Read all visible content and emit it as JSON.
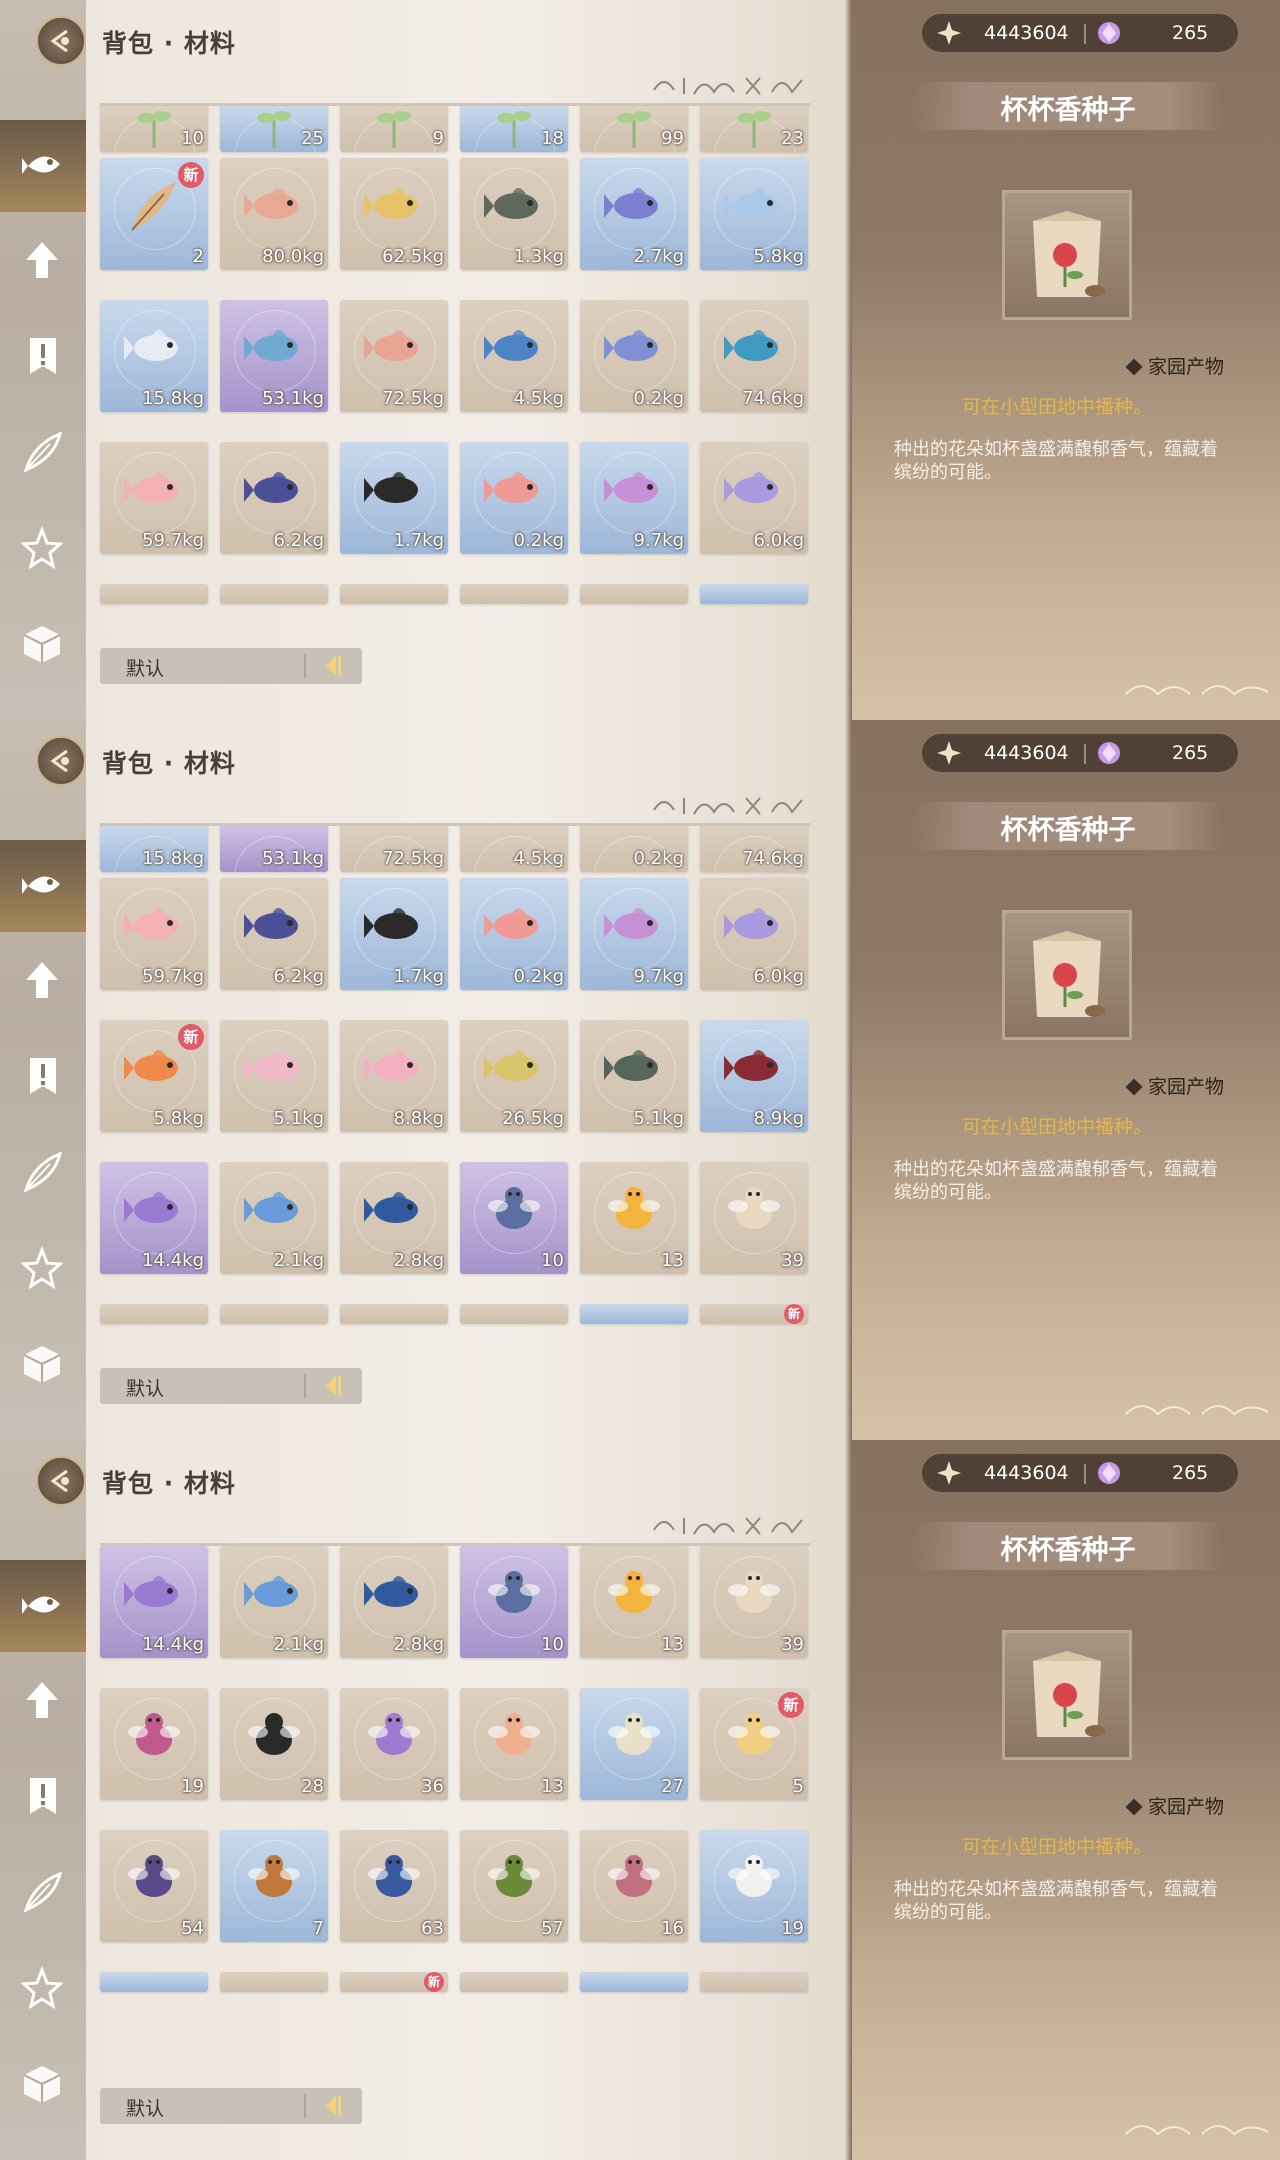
{
  "screens": [
    {
      "breadcrumb": "背包 · 材料",
      "sort_label": "默认",
      "currency": {
        "gold": "4443604",
        "gems": "265"
      },
      "detail": {
        "title": "杯杯香种子",
        "category": "家园产物",
        "usage": "可在小型田地中播种。",
        "description": "种出的花朵如杯盏盛满馥郁香气，蕴藏着缤纷的可能。"
      },
      "rows": [
        {
          "partial": "top",
          "items": [
            {
              "qty": "10",
              "color": "c-tan",
              "art": "sprout"
            },
            {
              "qty": "25",
              "color": "c-blue",
              "art": "sprout"
            },
            {
              "qty": "9",
              "color": "c-tan",
              "art": "sprout"
            },
            {
              "qty": "18",
              "color": "c-blue",
              "art": "sprout"
            },
            {
              "qty": "99",
              "color": "c-tan",
              "art": "sprout"
            },
            {
              "qty": "23",
              "color": "c-tan",
              "art": "sprout"
            }
          ]
        },
        {
          "items": [
            {
              "qty": "2",
              "color": "c-blue",
              "art": "feather",
              "new": "新"
            },
            {
              "qty": "80.0kg",
              "color": "c-tan",
              "art": "fish",
              "fish": "#e8a894"
            },
            {
              "qty": "62.5kg",
              "color": "c-tan",
              "art": "fish",
              "fish": "#e8c26a"
            },
            {
              "qty": "1.3kg",
              "color": "c-tan",
              "art": "fish",
              "fish": "#5f6a5c"
            },
            {
              "qty": "2.7kg",
              "color": "c-blue",
              "art": "fish",
              "fish": "#7c7fd0"
            },
            {
              "qty": "5.8kg",
              "color": "c-blue",
              "art": "fish",
              "fish": "#a9c9e8"
            }
          ]
        },
        {
          "items": [
            {
              "qty": "15.8kg",
              "color": "c-blue",
              "art": "fish",
              "fish": "#e7ecf2"
            },
            {
              "qty": "53.1kg",
              "color": "c-purple",
              "art": "fish",
              "fish": "#6fa8d0"
            },
            {
              "qty": "72.5kg",
              "color": "c-tan",
              "art": "fish",
              "fish": "#e9a393"
            },
            {
              "qty": "4.5kg",
              "color": "c-tan",
              "art": "fish",
              "fish": "#4d84c8"
            },
            {
              "qty": "0.2kg",
              "color": "c-tan",
              "art": "fish",
              "fish": "#7f90d4"
            },
            {
              "qty": "74.6kg",
              "color": "c-tan",
              "art": "fish",
              "fish": "#3f9ac4"
            }
          ]
        },
        {
          "items": [
            {
              "qty": "59.7kg",
              "color": "c-tan",
              "art": "fish",
              "fish": "#f3b1b3"
            },
            {
              "qty": "6.2kg",
              "color": "c-tan",
              "art": "fish",
              "fish": "#4a4f96"
            },
            {
              "qty": "1.7kg",
              "color": "c-blue",
              "art": "fish",
              "fish": "#2b2a2a"
            },
            {
              "qty": "0.2kg",
              "color": "c-blue",
              "art": "fish",
              "fish": "#f09a95"
            },
            {
              "qty": "9.7kg",
              "color": "c-blue",
              "art": "fish",
              "fish": "#c690d6"
            },
            {
              "qty": "6.0kg",
              "color": "c-tan",
              "art": "fish",
              "fish": "#a899e0"
            }
          ]
        },
        {
          "partial": "bottom",
          "items": [
            {
              "qty": "",
              "color": "c-tan",
              "art": "none"
            },
            {
              "qty": "",
              "color": "c-tan",
              "art": "none"
            },
            {
              "qty": "",
              "color": "c-tan",
              "art": "none"
            },
            {
              "qty": "",
              "color": "c-tan",
              "art": "none"
            },
            {
              "qty": "",
              "color": "c-tan",
              "art": "none"
            },
            {
              "qty": "",
              "color": "c-blue",
              "art": "none"
            }
          ]
        }
      ]
    },
    {
      "breadcrumb": "背包 · 材料",
      "sort_label": "默认",
      "currency": {
        "gold": "4443604",
        "gems": "265"
      },
      "detail": {
        "title": "杯杯香种子",
        "category": "家园产物",
        "usage": "可在小型田地中播种。",
        "description": "种出的花朵如杯盏盛满馥郁香气，蕴藏着缤纷的可能。"
      },
      "rows": [
        {
          "partial": "top",
          "items": [
            {
              "qty": "15.8kg",
              "color": "c-blue",
              "art": "none"
            },
            {
              "qty": "53.1kg",
              "color": "c-purple",
              "art": "none"
            },
            {
              "qty": "72.5kg",
              "color": "c-tan",
              "art": "none"
            },
            {
              "qty": "4.5kg",
              "color": "c-tan",
              "art": "none"
            },
            {
              "qty": "0.2kg",
              "color": "c-tan",
              "art": "none"
            },
            {
              "qty": "74.6kg",
              "color": "c-tan",
              "art": "none"
            }
          ]
        },
        {
          "items": [
            {
              "qty": "59.7kg",
              "color": "c-tan",
              "art": "fish",
              "fish": "#f3b1b3"
            },
            {
              "qty": "6.2kg",
              "color": "c-tan",
              "art": "fish",
              "fish": "#4a4f96"
            },
            {
              "qty": "1.7kg",
              "color": "c-blue",
              "art": "fish",
              "fish": "#2b2a2a"
            },
            {
              "qty": "0.2kg",
              "color": "c-blue",
              "art": "fish",
              "fish": "#f09a95"
            },
            {
              "qty": "9.7kg",
              "color": "c-blue",
              "art": "fish",
              "fish": "#c690d6"
            },
            {
              "qty": "6.0kg",
              "color": "c-tan",
              "art": "fish",
              "fish": "#a899e0"
            }
          ]
        },
        {
          "items": [
            {
              "qty": "5.8kg",
              "color": "c-tan",
              "art": "fish",
              "fish": "#f08a4a",
              "new": "新"
            },
            {
              "qty": "5.1kg",
              "color": "c-tan",
              "art": "fish",
              "fish": "#f2b8c8"
            },
            {
              "qty": "8.8kg",
              "color": "c-tan",
              "art": "fish",
              "fish": "#f2b0c2"
            },
            {
              "qty": "26.5kg",
              "color": "c-tan",
              "art": "fish",
              "fish": "#d8c46a"
            },
            {
              "qty": "5.1kg",
              "color": "c-tan",
              "art": "fish",
              "fish": "#56665a"
            },
            {
              "qty": "8.9kg",
              "color": "c-blue",
              "art": "fish",
              "fish": "#8a2a35"
            }
          ]
        },
        {
          "items": [
            {
              "qty": "14.4kg",
              "color": "c-purple",
              "art": "fish",
              "fish": "#9a7ad0"
            },
            {
              "qty": "2.1kg",
              "color": "c-tan",
              "art": "fish",
              "fish": "#6a9ad8"
            },
            {
              "qty": "2.8kg",
              "color": "c-tan",
              "art": "fish",
              "fish": "#2f5aa0"
            },
            {
              "qty": "10",
              "color": "c-purple",
              "art": "bug",
              "fish": "#5a6fa0"
            },
            {
              "qty": "13",
              "color": "c-tan",
              "art": "bug",
              "fish": "#f2b43c"
            },
            {
              "qty": "39",
              "color": "c-tan",
              "art": "bug",
              "fish": "#e8d8c0"
            }
          ]
        },
        {
          "partial": "bottom",
          "items": [
            {
              "qty": "",
              "color": "c-tan",
              "art": "none"
            },
            {
              "qty": "",
              "color": "c-tan",
              "art": "none"
            },
            {
              "qty": "",
              "color": "c-tan",
              "art": "none"
            },
            {
              "qty": "",
              "color": "c-tan",
              "art": "none"
            },
            {
              "qty": "",
              "color": "c-blue",
              "art": "none"
            },
            {
              "qty": "",
              "color": "c-tan",
              "art": "none",
              "new": "新"
            }
          ]
        }
      ]
    },
    {
      "breadcrumb": "背包 · 材料",
      "sort_label": "默认",
      "currency": {
        "gold": "4443604",
        "gems": "265"
      },
      "detail": {
        "title": "杯杯香种子",
        "category": "家园产物",
        "usage": "可在小型田地中播种。",
        "description": "种出的花朵如杯盏盛满馥郁香气，蕴藏着缤纷的可能。"
      },
      "rows": [
        {
          "items": [
            {
              "qty": "14.4kg",
              "color": "c-purple",
              "art": "fish",
              "fish": "#9a7ad0"
            },
            {
              "qty": "2.1kg",
              "color": "c-tan",
              "art": "fish",
              "fish": "#6a9ad8"
            },
            {
              "qty": "2.8kg",
              "color": "c-tan",
              "art": "fish",
              "fish": "#2f5aa0"
            },
            {
              "qty": "10",
              "color": "c-purple",
              "art": "bug",
              "fish": "#5a6fa0"
            },
            {
              "qty": "13",
              "color": "c-tan",
              "art": "bug",
              "fish": "#f2b43c"
            },
            {
              "qty": "39",
              "color": "c-tan",
              "art": "bug",
              "fish": "#e8d8c0"
            }
          ]
        },
        {
          "items": [
            {
              "qty": "19",
              "color": "c-tan",
              "art": "bug",
              "fish": "#c05a8a"
            },
            {
              "qty": "28",
              "color": "c-tan",
              "art": "bug",
              "fish": "#2b2a2a"
            },
            {
              "qty": "36",
              "color": "c-tan",
              "art": "bug",
              "fish": "#a07ad0"
            },
            {
              "qty": "13",
              "color": "c-tan",
              "art": "bug",
              "fish": "#f0b090"
            },
            {
              "qty": "27",
              "color": "c-blue",
              "art": "bug",
              "fish": "#e8e0c8"
            },
            {
              "qty": "5",
              "color": "c-tan",
              "art": "bug",
              "fish": "#f0d080",
              "new": "新"
            }
          ]
        },
        {
          "items": [
            {
              "qty": "54",
              "color": "c-tan",
              "art": "bug",
              "fish": "#5a4a8a"
            },
            {
              "qty": "7",
              "color": "c-blue",
              "art": "bug",
              "fish": "#c0783c"
            },
            {
              "qty": "63",
              "color": "c-tan",
              "art": "bug",
              "fish": "#3a5aa0"
            },
            {
              "qty": "57",
              "color": "c-tan",
              "art": "bug",
              "fish": "#6a8a3a"
            },
            {
              "qty": "16",
              "color": "c-tan",
              "art": "bug",
              "fish": "#c07080"
            },
            {
              "qty": "19",
              "color": "c-blue",
              "art": "bug",
              "fish": "#f0f0f0"
            }
          ]
        },
        {
          "partial": "bottom",
          "items": [
            {
              "qty": "",
              "color": "c-blue",
              "art": "none"
            },
            {
              "qty": "",
              "color": "c-tan",
              "art": "none"
            },
            {
              "qty": "",
              "color": "c-tan",
              "art": "none",
              "new": "新"
            },
            {
              "qty": "",
              "color": "c-tan",
              "art": "none"
            },
            {
              "qty": "",
              "color": "c-blue",
              "art": "none"
            },
            {
              "qty": "",
              "color": "c-tan",
              "art": "none"
            }
          ]
        }
      ]
    }
  ]
}
